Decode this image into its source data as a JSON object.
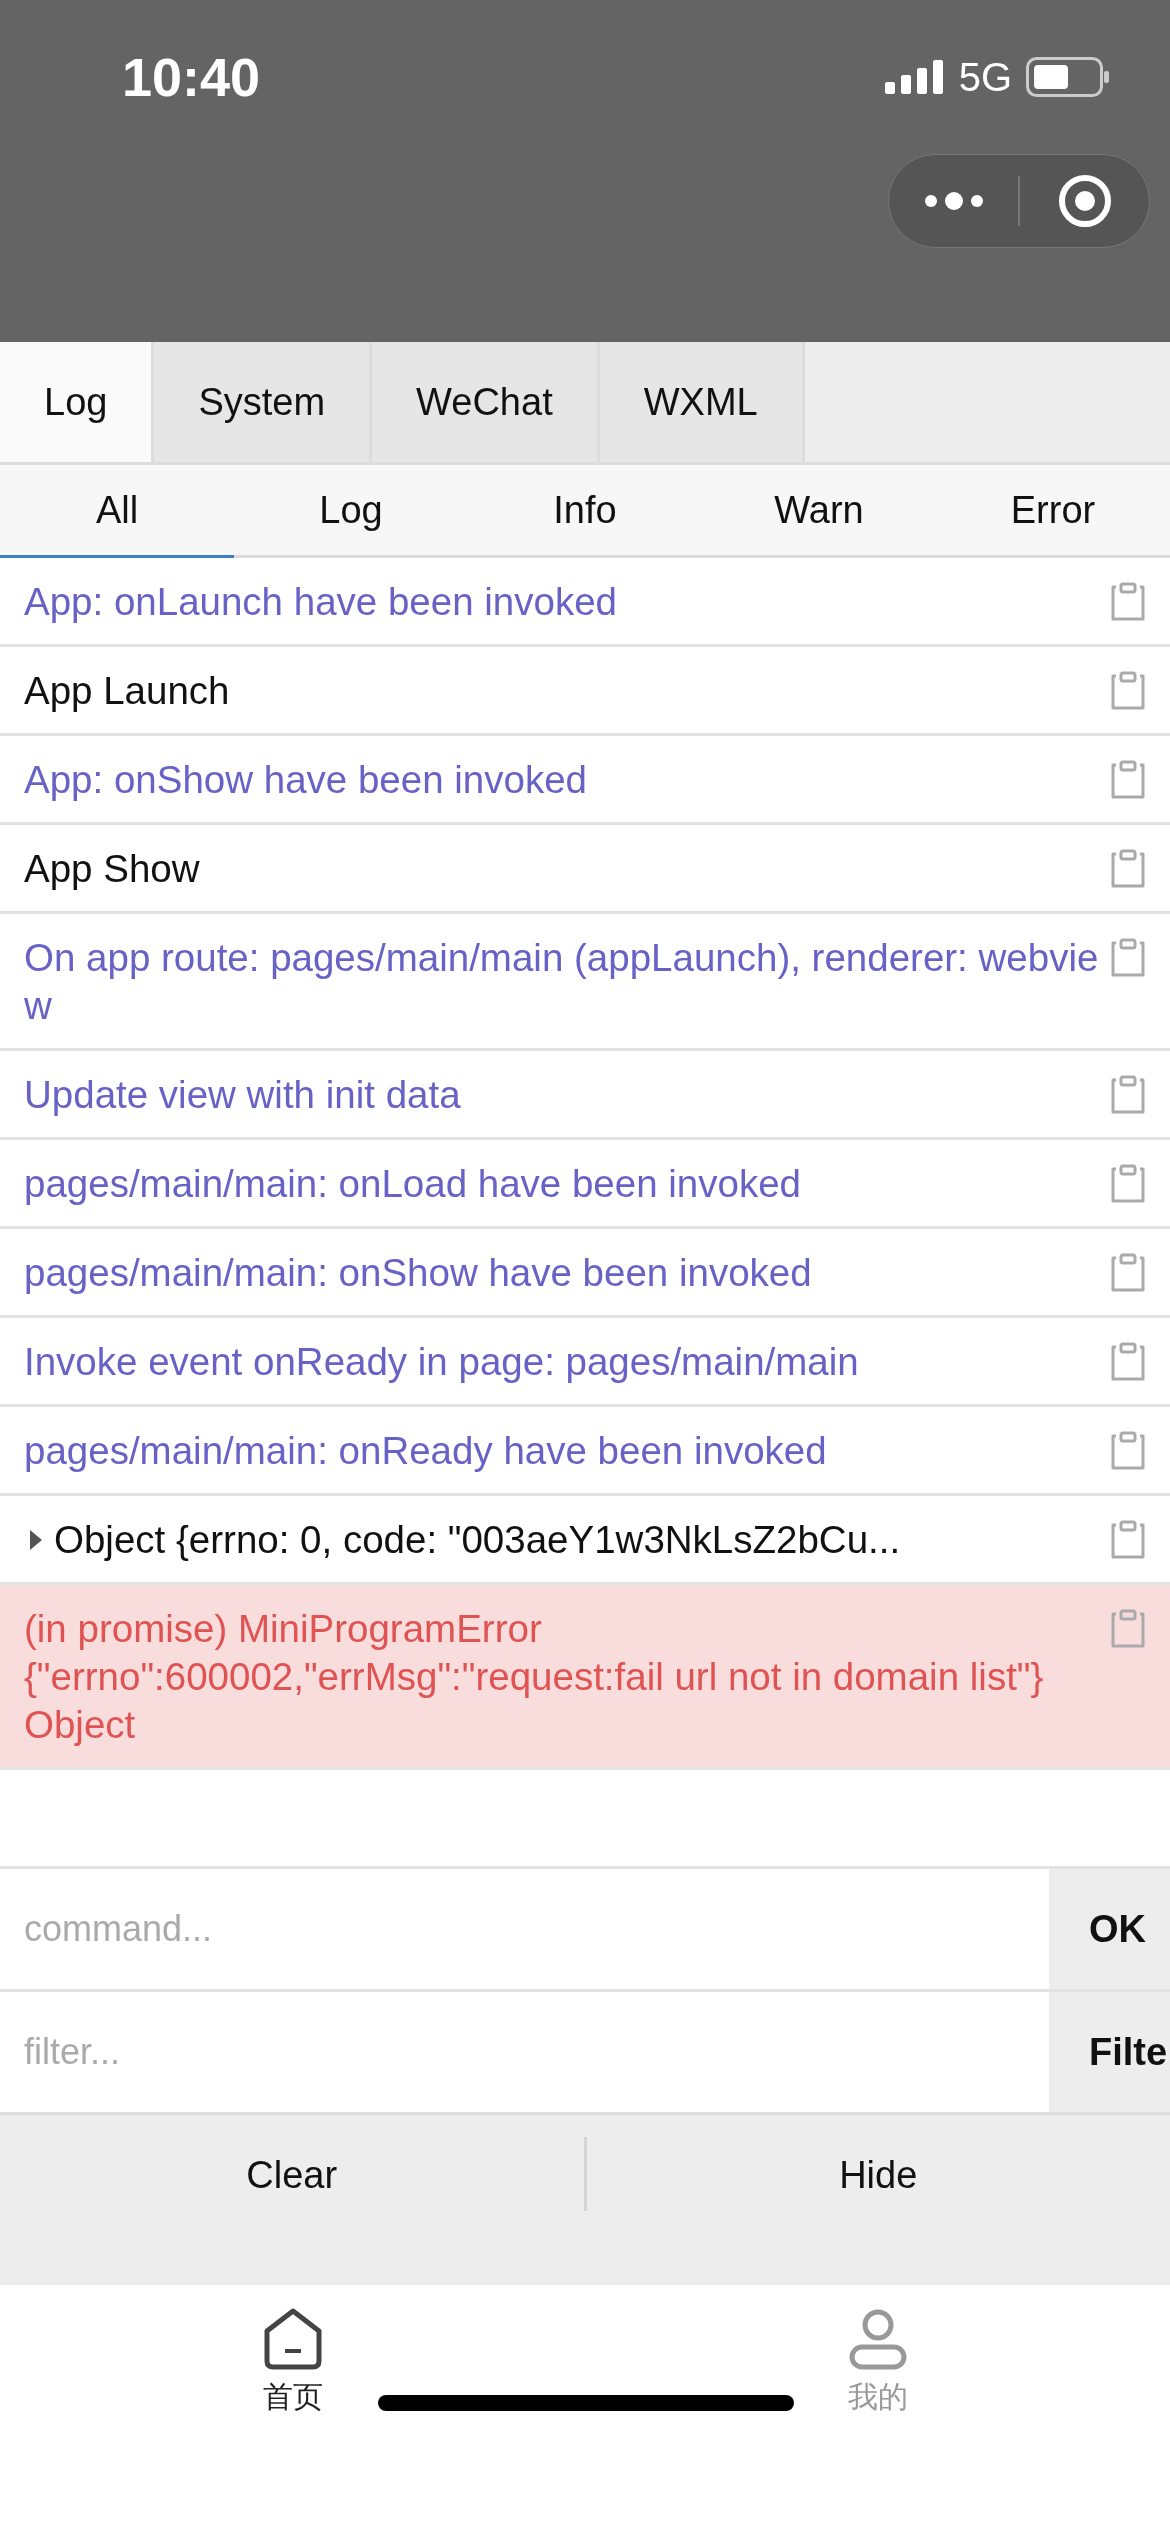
{
  "status_bar": {
    "time": "10:40",
    "network": "5G"
  },
  "panel_tabs": [
    {
      "label": "Log",
      "selected": true
    },
    {
      "label": "System",
      "selected": false
    },
    {
      "label": "WeChat",
      "selected": false
    },
    {
      "label": "WXML",
      "selected": false
    }
  ],
  "filter_tabs": [
    {
      "label": "All",
      "selected": true
    },
    {
      "label": "Log",
      "selected": false
    },
    {
      "label": "Info",
      "selected": false
    },
    {
      "label": "Warn",
      "selected": false
    },
    {
      "label": "Error",
      "selected": false
    }
  ],
  "log_rows": [
    {
      "kind": "info",
      "text": "App: onLaunch have been invoked"
    },
    {
      "kind": "log",
      "text": "App Launch"
    },
    {
      "kind": "info",
      "text": "App: onShow have been invoked"
    },
    {
      "kind": "log",
      "text": "App Show"
    },
    {
      "kind": "info",
      "text": "On app route: pages/main/main (appLaunch), renderer: webview"
    },
    {
      "kind": "info",
      "text": "Update view with init data"
    },
    {
      "kind": "info",
      "text": "pages/main/main: onLoad have been invoked"
    },
    {
      "kind": "info",
      "text": "pages/main/main: onShow have been invoked"
    },
    {
      "kind": "info",
      "text": "Invoke event onReady in page: pages/main/main"
    },
    {
      "kind": "info",
      "text": "pages/main/main: onReady have been invoked"
    },
    {
      "kind": "object",
      "expanded": false,
      "text": "Object {errno: 0, code: \"003aeY1w3NkLsZ2bCu..."
    },
    {
      "kind": "error",
      "text": "(in promise) MiniProgramError\n{\"errno\":600002,\"errMsg\":\"request:fail url not in domain list\"}\nObject"
    }
  ],
  "inputs": [
    {
      "placeholder": "command...",
      "button": "OK"
    },
    {
      "placeholder": "filter...",
      "button": "Filte"
    }
  ],
  "actions": [
    "Clear",
    "Hide"
  ],
  "tab_bar": [
    {
      "label": "首页",
      "kind": "home",
      "selected": true
    },
    {
      "label": "我的",
      "kind": "profile",
      "selected": false
    }
  ]
}
